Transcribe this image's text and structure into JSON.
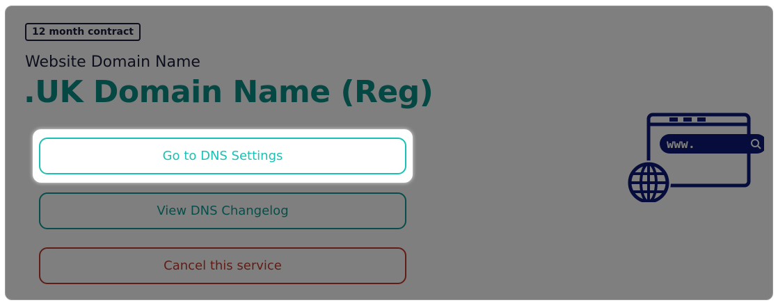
{
  "card": {
    "badge": "12 month contract",
    "subtitle": "Website Domain Name",
    "title": ".UK Domain Name (Reg)"
  },
  "actions": {
    "dns_settings": "Go to DNS Settings",
    "dns_changelog": "View DNS Changelog",
    "cancel": "Cancel this service"
  },
  "illustration": {
    "icon": "browser-www-globe-icon",
    "browser_text": "www."
  },
  "colors": {
    "accent_teal": "#19c0b5",
    "title_teal": "#0b8f87",
    "danger": "#c0392b",
    "navy": "#0d1a7a",
    "overlay": "rgba(0,0,0,0.5)"
  }
}
